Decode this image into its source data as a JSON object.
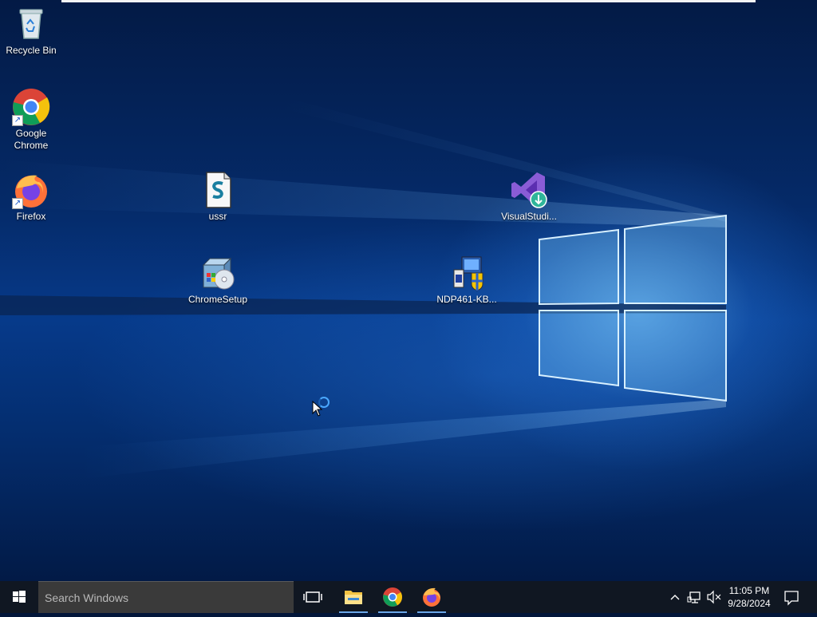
{
  "desktop": {
    "icons": [
      {
        "id": "recycle-bin",
        "label": "Recycle Bin",
        "icon": "recycle-bin-icon"
      },
      {
        "id": "google-chrome",
        "label": "Google Chrome",
        "icon": "chrome-icon"
      },
      {
        "id": "firefox",
        "label": "Firefox",
        "icon": "firefox-icon"
      },
      {
        "id": "ussr",
        "label": "ussr",
        "icon": "script-file-icon"
      },
      {
        "id": "chromesetup",
        "label": "ChromeSetup",
        "icon": "installer-icon"
      },
      {
        "id": "ndp461",
        "label": "NDP461-KB...",
        "icon": "setup-icon"
      },
      {
        "id": "visualstudio",
        "label": "VisualStudi...",
        "icon": "visual-studio-installer-icon"
      }
    ]
  },
  "taskbar": {
    "search_placeholder": "Search Windows",
    "pinned": [
      {
        "name": "file-explorer",
        "icon": "folder-icon"
      },
      {
        "name": "google-chrome",
        "icon": "chrome-icon"
      },
      {
        "name": "firefox",
        "icon": "firefox-icon"
      }
    ],
    "tray": {
      "time": "11:05 PM",
      "date": "9/28/2024",
      "icons": [
        "chevron-up-icon",
        "network-icon",
        "volume-muted-icon",
        "notification-icon"
      ]
    }
  },
  "colors": {
    "taskbar": "#101722",
    "accent": "#6aa6e8"
  }
}
